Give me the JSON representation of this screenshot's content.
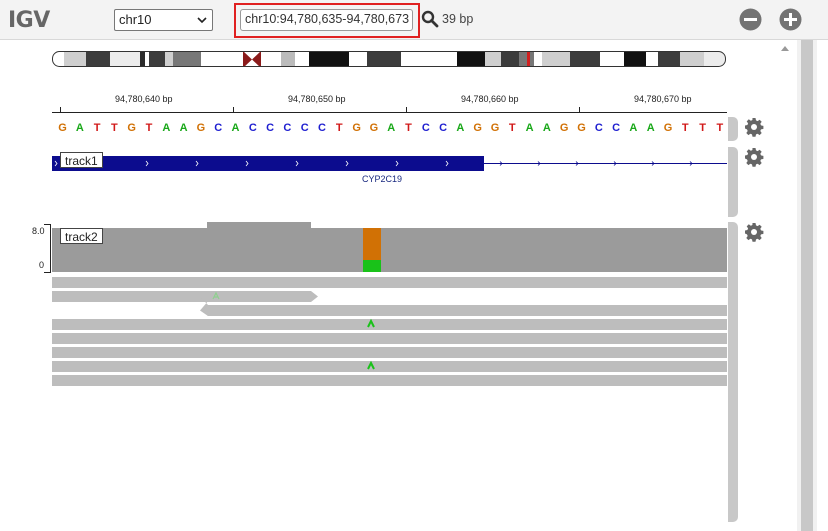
{
  "app": {
    "title": "IGV"
  },
  "toolbar": {
    "chromosome": "chr10",
    "locus": "chr10:94,780,635-94,780,673",
    "bp_span": "39 bp"
  },
  "ruler": {
    "ticks": [
      "94,780,640 bp",
      "94,780,650 bp",
      "94,780,660 bp",
      "94,780,670 bp"
    ]
  },
  "sequence": {
    "bases": [
      "G",
      "A",
      "T",
      "T",
      "G",
      "T",
      "A",
      "A",
      "G",
      "C",
      "A",
      "C",
      "C",
      "C",
      "C",
      "C",
      "T",
      "G",
      "G",
      "A",
      "T",
      "C",
      "C",
      "A",
      "G",
      "G",
      "T",
      "A",
      "A",
      "G",
      "G",
      "C",
      "C",
      "A",
      "A",
      "G",
      "T",
      "T",
      "T"
    ],
    "colors": {
      "A": "#19a819",
      "C": "#1f1fd0",
      "G": "#d17105",
      "T": "#d11818"
    }
  },
  "tracks": [
    {
      "label": "track1",
      "gene": "CYP2C19"
    },
    {
      "label": "track2",
      "coverage_max": "8.0",
      "coverage_min": "0"
    }
  ],
  "colors": {
    "gene": "#0c0c8e",
    "coverage": "#9b9b9b",
    "read": "#bdbdbd",
    "mismatch_bar_top": "#d17105",
    "mismatch_bar_bottom": "#19c219",
    "highlight": "#e02020"
  },
  "icons": [
    "search-icon",
    "zoom-out-icon",
    "zoom-in-icon",
    "gear-icon",
    "chevron-down-icon"
  ]
}
